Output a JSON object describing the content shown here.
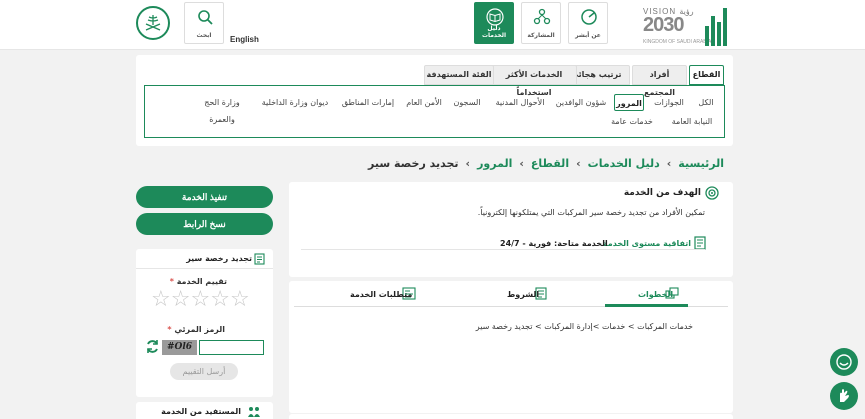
{
  "header": {
    "vision": {
      "title": "VISION رؤية",
      "year": "2030",
      "sub": "KINGDOM OF SAUDI ARABIA"
    },
    "buttons": [
      {
        "key": "services_guide",
        "label": "دليل الخدمات",
        "active": true
      },
      {
        "key": "participation",
        "label": "المشاركة",
        "active": false
      },
      {
        "key": "absher",
        "label": "عن أبشر",
        "active": false
      },
      {
        "key": "search",
        "label": "ابحث",
        "active": false
      }
    ],
    "english": "English"
  },
  "sector_tabs": [
    "القطاع",
    "أفراد المجتمع",
    "ترتيب هجائي",
    "الخدمات الأكثر استخداماً",
    "الفئة المستهدفة"
  ],
  "categories": [
    "الكل",
    "الجوازات",
    "المرور",
    "شؤون الوافدين",
    "الأحوال المدنية",
    "السجون",
    "الأمن العام",
    "إمارات المناطق",
    "ديوان وزارة الداخلية",
    "وزارة الحج والعمرة",
    "النيابة العامة",
    "خدمات عامة"
  ],
  "active_category": "المرور",
  "breadcrumb": [
    "الرئيسية",
    "دليل الخدمات",
    "القطاع",
    "المرور",
    "تجديد رخصة سير"
  ],
  "goal": {
    "title": "الهدف من الخدمة",
    "description": "تمكين الأفراد من تجديد رخصة سير المركبات التي يمتلكونها إلكترونياً.",
    "sla_label": "اتفاقية مستوى الخدمة",
    "availability": "الخدمة متاحة: فورية - 24/7"
  },
  "service_tabs": [
    {
      "label": "الخطوات",
      "active": true
    },
    {
      "label": "الشروط",
      "active": false
    },
    {
      "label": "متطلبات الخدمة",
      "active": false
    }
  ],
  "steps_text": "خدمات المركبات > خدمات >إدارة المركبات > تجديد رخصة سير",
  "actions": {
    "execute": "تنفيذ الخدمة",
    "copy_link": "نسخ الرابط"
  },
  "rating": {
    "title": "تجديد رخصة سير",
    "rate_label": "تقييم الخدمة",
    "required_mark": "*",
    "stars_count": 5,
    "captcha_label": "الرمز المرئي",
    "captcha_text": "#Ol6",
    "send_label": "أرسل التقييم"
  },
  "beneficiary": {
    "title": "المستفيد من الخدمة"
  },
  "colors": {
    "primary": "#1d8a5a"
  }
}
